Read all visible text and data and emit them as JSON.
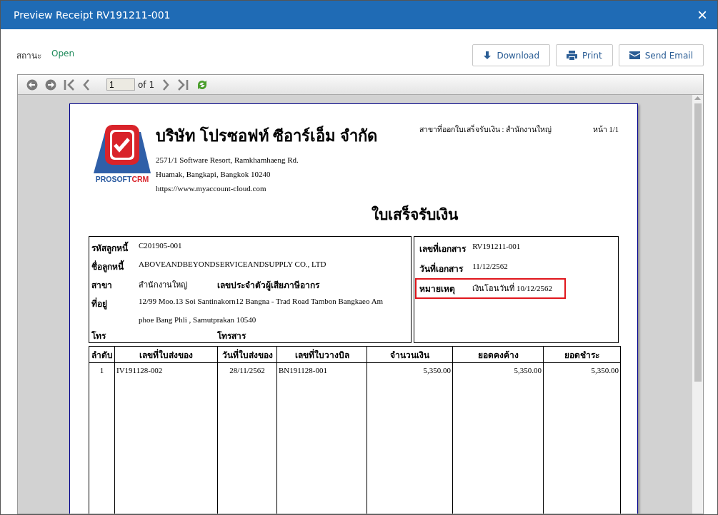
{
  "window": {
    "title": "Preview Receipt RV191211-001",
    "close": "×"
  },
  "status": {
    "label": "สถานะ",
    "value": "Open"
  },
  "buttons": [
    {
      "kind": "download",
      "label": "Download"
    },
    {
      "kind": "print",
      "label": "Print"
    },
    {
      "kind": "email",
      "label": "Send Email"
    }
  ],
  "viewer_toolbar": {
    "page_field": "1",
    "page_total": "of 1"
  },
  "report": {
    "logo": {
      "word_1": "PROSOFT",
      "word_2": "CRM"
    },
    "company": {
      "name": "บริษัท โปรซอฟท์ ซีอาร์เอ็ม จำกัด",
      "address_lines": [
        "2571/1 Software Resort, Ramkhamhaeng Rd.",
        "Huamak, Bangkapi, Bangkok 10240"
      ],
      "website": "https://www.myaccount-cloud.com"
    },
    "issuing_branch": "สาขาที่ออกใบเสร็จรับเงิน : สำนักงานใหญ่",
    "page": "หน้า 1/1",
    "title": "ใบเสร็จรับเงิน",
    "customer_fields": [
      {
        "label": "รหัสลูกหนี้",
        "lines": [
          "C201905-001"
        ]
      },
      {
        "label": "ชื่อลูกหนี้",
        "lines": [
          "ABOVEANDBEYONDSERVICEANDSUPPLY CO., LTD"
        ]
      },
      {
        "label": "สาขา",
        "lines": [
          "สำนักงานใหญ่"
        ],
        "extra_label": "เลขประจำตัวผู้เสียภาษีอากร"
      },
      {
        "label": "ที่อยู่",
        "lines": [
          " 12/99 Moo.13 Soi Santinakorn12 Bangna - Trad Road Tambon Bangkaeo Am",
          "phoe Bang Phli , Samutprakan  10540"
        ]
      },
      {
        "label": "โทร",
        "extra_label": "โทรสาร"
      }
    ],
    "document_fields": [
      {
        "label": "เลขที่เอกสาร",
        "value": "RV191211-001",
        "highlighted": false
      },
      {
        "label": "วันที่เอกสาร",
        "value": "11/12/2562",
        "highlighted": false
      },
      {
        "label": "หมายเหตุ",
        "value": "เงินโอนวันที่ 10/12/2562",
        "highlighted": true
      }
    ],
    "table": {
      "columns": [
        "ลำดับ",
        "เลขที่ใบส่งของ",
        "วันที่ใบส่งของ",
        "เลขที่ใบวางบิล",
        "จำนวนเงิน",
        "ยอดคงค้าง",
        "ยอดชำระ"
      ],
      "rows": [
        [
          "1",
          "IV191128-002",
          "28/11/2562",
          "BN191128-001",
          "5,350.00",
          "5,350.00",
          "5,350.00"
        ]
      ]
    }
  }
}
